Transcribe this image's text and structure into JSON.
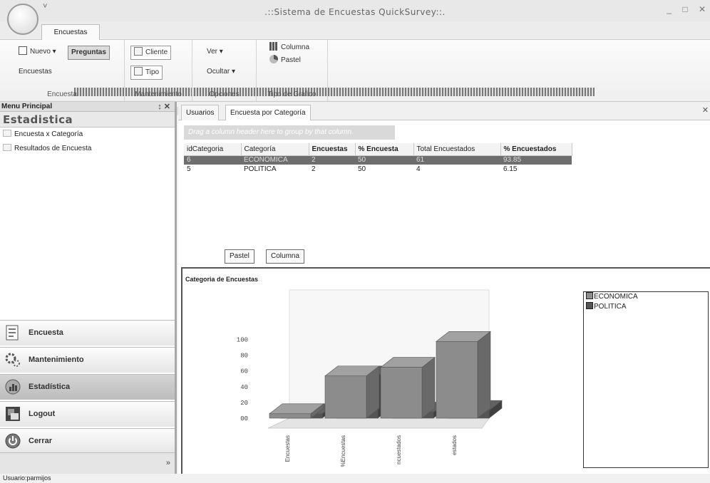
{
  "window": {
    "title": ".::Sistema de Encuestas QuickSurvey::.",
    "qat_glyph": "˅",
    "buttons": [
      "_",
      "□",
      "✕"
    ]
  },
  "ribbon": {
    "tab": "Encuestas",
    "groups": {
      "encuesta": {
        "label": "Encuesta",
        "nuevo": "Nuevo",
        "preguntas": "Preguntas",
        "encuestas": "Encuestas"
      },
      "mantenimiento": {
        "label": "Mantenimiento",
        "cliente": "Cliente",
        "tipo": "Tipo"
      },
      "opciones": {
        "label": "Opciones",
        "ver": "Ver",
        "ocultar": "Ocultar"
      },
      "tipo_grafico": {
        "label": "Tipo de Gráfico",
        "columna": "Columna",
        "pastel": "Pastel"
      }
    }
  },
  "menu": {
    "header": "Menu Principal",
    "pin_close": "↕ ✕",
    "section": "Estadistica",
    "items": [
      "Encuesta x Categoría",
      "Resultados de Encuesta"
    ],
    "dots": "...........",
    "nav": [
      "Encuesta",
      "Mantenimiento",
      "Estadística",
      "Logout",
      "Cerrar"
    ],
    "chevron": "»"
  },
  "content": {
    "tabs": [
      "Usuarios",
      "Encuesta por Categoría"
    ],
    "close_glyph": "✕",
    "groupby_hint": "Drag a column header here to group by that column.",
    "columns": [
      "idCategoria",
      "Categoría",
      "Encuestas",
      "% Encuesta",
      "Total Encuestados",
      "% Encuestados"
    ],
    "rows": [
      [
        "6",
        "ECONOMICA",
        "2",
        "50",
        "61",
        "93.85"
      ],
      [
        "5",
        "POLITICA",
        "2",
        "50",
        "4",
        "6.15"
      ]
    ],
    "buttons": {
      "pastel": "Pastel",
      "columna": "Columna"
    }
  },
  "chart_data": {
    "type": "bar",
    "title": "Categoria de Encuestas",
    "categories": [
      "Encuestas",
      "%Encuestas",
      "ncuestados",
      "estados"
    ],
    "series": [
      {
        "name": "ECONOMICA",
        "values": [
          2,
          50,
          61,
          93.85
        ]
      },
      {
        "name": "POLITICA",
        "values": [
          2,
          50,
          4,
          6.15
        ]
      }
    ],
    "yticks": [
      "00",
      "20",
      "40",
      "60",
      "80",
      "100"
    ],
    "ylim": [
      0,
      100
    ],
    "legend": "right",
    "colors": {
      "ECONOMICA": "#8c8c8c",
      "POLITICA": "#555555"
    }
  },
  "status": {
    "user": "Usuario:parmijos"
  }
}
